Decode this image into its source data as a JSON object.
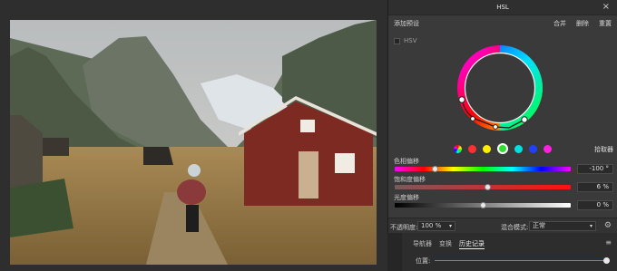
{
  "hsl_panel": {
    "title": "HSL",
    "close_glyph": "×",
    "add_preset": "添加预设",
    "actions": [
      "合并",
      "删除",
      "重置"
    ],
    "hsv_label": "HSV",
    "picker_label": "拾取器",
    "swatch_colors": [
      "#ff3030",
      "#ffee00",
      "#30e030",
      "#00e0e0",
      "#2040ff",
      "#ff20e0"
    ],
    "hue": {
      "label": "色相偏移",
      "value": "-100 °",
      "level": 0.23
    },
    "saturation": {
      "label": "饱和度偏移",
      "value": "6 %",
      "level": 0.53
    },
    "luminosity": {
      "label": "光度偏移",
      "value": "0 %",
      "level": 0.5
    },
    "opacity_label": "不透明度:",
    "opacity_value": "100 %",
    "blend_label": "混合模式:",
    "blend_value": "正常",
    "caret": "▾",
    "gear_icon": "gear-icon"
  },
  "lower_panel": {
    "tabs": [
      "导航器",
      "变换",
      "历史记录"
    ],
    "active_tab": "历史记录",
    "menu_icon": "≡",
    "position_label": "位置:",
    "position_level": 1.0
  },
  "accent": "#4a8fd8"
}
